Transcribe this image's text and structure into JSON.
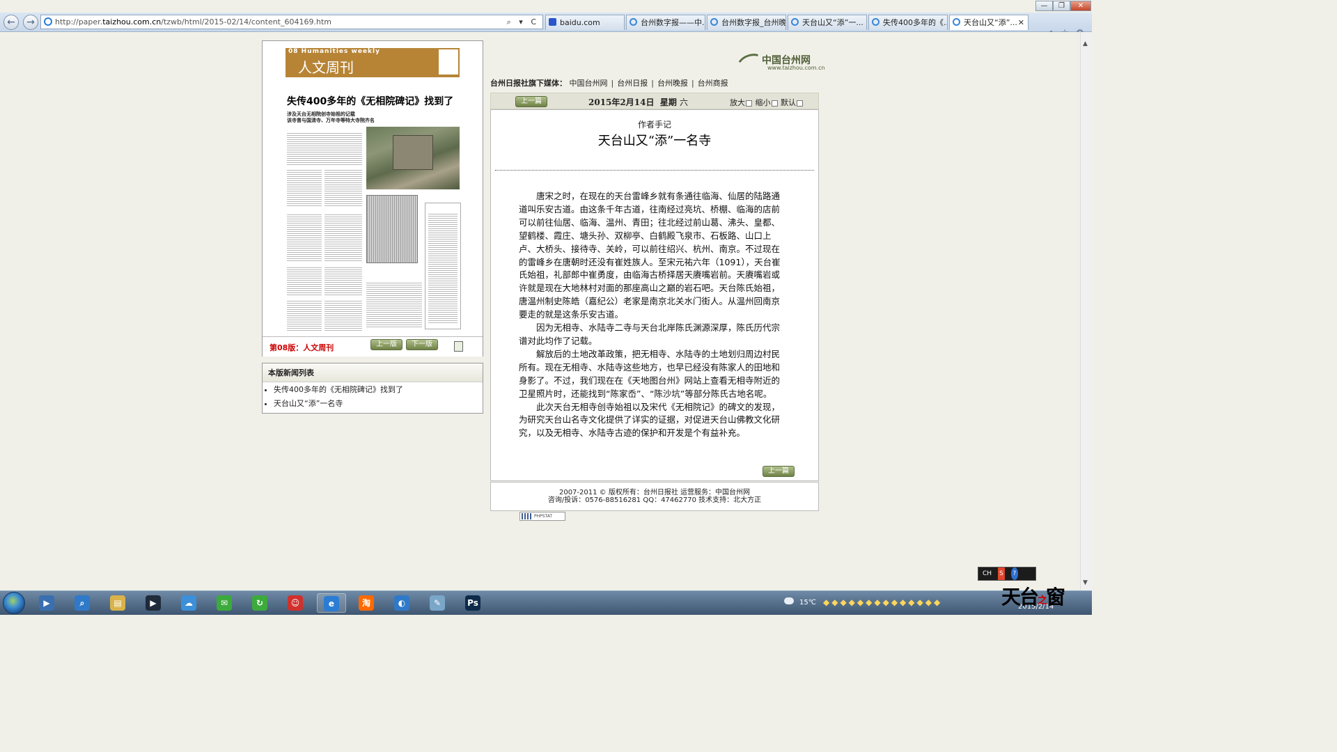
{
  "browser": {
    "url_prefix": "http://paper.",
    "url_domain": "taizhou.com.cn",
    "url_rest": "/tzwb/html/2015-02/14/content_604169.htm",
    "address_tools": "⌕ ▾ C",
    "back_icon": "←",
    "forward_icon": "→",
    "tabs": [
      {
        "label": "baidu.com",
        "active": false,
        "icon": "paw-icon"
      },
      {
        "label": "台州数字报——中...",
        "active": false,
        "icon": "ie-icon"
      },
      {
        "label": "台州数字报_台州晚...",
        "active": false,
        "icon": "ie-icon"
      },
      {
        "label": "天台山又“添”一...",
        "active": false,
        "icon": "ie-icon"
      },
      {
        "label": "失传400多年的《...",
        "active": false,
        "icon": "ie-icon"
      },
      {
        "label": "天台山又“添”...",
        "active": true,
        "icon": "ie-icon"
      }
    ],
    "tab_close": "✕",
    "right_tools": "⌂☆⚙",
    "window_buttons": [
      "—",
      "❐",
      "✕"
    ]
  },
  "page_thumb": {
    "header_en": "08 Humanities weekly",
    "header_cn": "人文周刊",
    "headline": "失传400多年的《无相院碑记》找到了",
    "sub1": "涉及天台无相院创寺始祖的记载",
    "sub2": "该寺曾与国清寺、万年寺等特大寺院齐名",
    "page_name": "第08版：人文周刊",
    "prev_page": "上一版",
    "next_page": "下一版"
  },
  "news_list": {
    "title": "本版新闻列表",
    "items": [
      "失传400多年的《无相院碑记》找到了",
      "天台山又“添”一名寺"
    ]
  },
  "site": {
    "logo_name": "中国台州网",
    "logo_url": "www.taizhou.com.cn",
    "media_label": "台州日报社旗下媒体：",
    "media_links": [
      "中国台州网",
      "台州日报",
      "台州晚报",
      "台州商报"
    ]
  },
  "toolbar": {
    "prev_article": "上一篇",
    "date": "2015年2月14日",
    "weekday_label": "星期",
    "weekday": "六",
    "zoom_in": "放大",
    "zoom_out": "缩小",
    "default": "默认"
  },
  "article": {
    "kicker": "作者手记",
    "title": "天台山又“添”一名寺",
    "paragraphs": [
      "唐宋之时，在现在的天台雷峰乡就有条通往临海、仙居的陆路通道叫乐安古道。由这条千年古道，往南经过亮坑、桥棚、临海的店前可以前往仙居、临海、温州、青田；往北经过前山葛、沸头、皇都、望鹤楼、霞庄、塘头孙、双柳亭、白鹤殿飞泉市、石板路、山口上卢、大桥头、接待寺、关岭，可以前往绍兴、杭州、南京。不过现在的雷峰乡在唐朝时还没有崔姓族人。至宋元祐六年（1091），天台崔氏始祖，礼部郎中崔勇度，由临海古桥择居天赓嘴岩前。天赓嘴岩或许就是现在大地林村对面的那座高山之巅的岩石吧。天台陈氏始祖，唐温州制史陈皓（嘉纪公）老家是南京北关水门街人。从温州回南京要走的就是这条乐安古道。",
      "因为无相寺、水陆寺二寺与天台北岸陈氏渊源深厚，陈氏历代宗谱对此均作了记载。",
      "解放后的土地改革政策，把无相寺、水陆寺的土地划归周边村民所有。现在无相寺、水陆寺这些地方，也早已经没有陈家人的田地和身影了。不过，我们现在在《天地图台州》网站上查看无相寺附近的卫星照片时，还能找到“陈家岙”、“陈沙坑”等部分陈氏古地名呢。",
      "此次天台无相寺创寺始祖以及宋代《无相院记》的碑文的发现，为研究天台山名寺文化提供了详实的证据，对促进天台山佛教文化研究，以及无相寺、水陆寺古迹的保护和开发是个有益补充。"
    ],
    "prev_article_bottom": "上一篇"
  },
  "footer": {
    "line1": "2007-2011 © 版权所有：台州日报社 运营服务：中国台州网",
    "line2": "咨询/投诉：0576-88516281 QQ：47462770 技术支持：北大方正"
  },
  "phpstat": "PHPSTAT",
  "ime": {
    "lang": "CH",
    "s": "S",
    "help": "?"
  },
  "taskbar": {
    "apps": [
      {
        "icon": "media-player-icon",
        "glyph": "▶",
        "color": "#3a6fb0",
        "active": false
      },
      {
        "icon": "search-icon",
        "glyph": "⌕",
        "color": "#2f79c8",
        "active": false
      },
      {
        "icon": "explorer-icon",
        "glyph": "▤",
        "color": "#d9b24a",
        "active": false
      },
      {
        "icon": "video-icon",
        "glyph": "▶",
        "color": "#1f2a3a",
        "active": false
      },
      {
        "icon": "baidu-cloud-icon",
        "glyph": "☁",
        "color": "#3c8fd9",
        "active": false
      },
      {
        "icon": "wechat-icon",
        "glyph": "✉",
        "color": "#3caa3c",
        "active": false
      },
      {
        "icon": "update-icon",
        "glyph": "↻",
        "color": "#3caa3c",
        "active": false
      },
      {
        "icon": "tmall-icon",
        "glyph": "☺",
        "color": "#d0312d",
        "active": false
      },
      {
        "icon": "ie-icon",
        "glyph": "e",
        "color": "#2b7cd3",
        "active": true
      },
      {
        "icon": "taobao-icon",
        "glyph": "淘",
        "color": "#ff6a00",
        "active": false
      },
      {
        "icon": "browser-icon",
        "glyph": "◐",
        "color": "#2f79c8",
        "active": false
      },
      {
        "icon": "notepad-icon",
        "glyph": "✎",
        "color": "#7aa6c8",
        "active": false
      },
      {
        "icon": "photoshop-icon",
        "glyph": "Ps",
        "color": "#0e2a4a",
        "active": false
      }
    ],
    "temperature": "15℃",
    "tray_icons": "◆◆◆◆◆◆◆◆◆◆◆◆◆◆",
    "date": "2015/2/14"
  },
  "watermark": {
    "text": "天台",
    "small": "之",
    "text2": "窗"
  }
}
